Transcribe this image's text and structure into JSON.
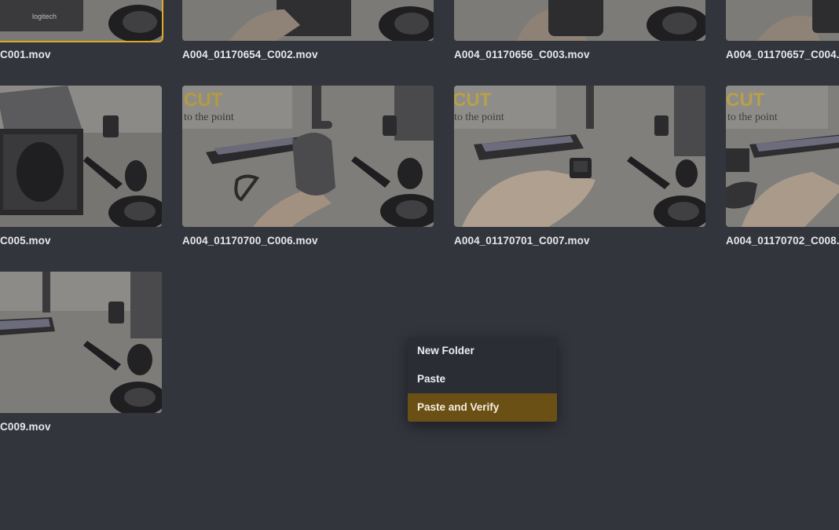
{
  "clips": [
    {
      "id": "c001",
      "name": "C001.mov",
      "selected": true
    },
    {
      "id": "c002",
      "name": "A004_01170654_C002.mov",
      "selected": false
    },
    {
      "id": "c003",
      "name": "A004_01170656_C003.mov",
      "selected": false
    },
    {
      "id": "c004",
      "name": "A004_01170657_C004.",
      "selected": false
    },
    {
      "id": "c005",
      "name": "C005.mov",
      "selected": false
    },
    {
      "id": "c006",
      "name": "A004_01170700_C006.mov",
      "selected": false
    },
    {
      "id": "c007",
      "name": "A004_01170701_C007.mov",
      "selected": false
    },
    {
      "id": "c008",
      "name": "A004_01170702_C008.",
      "selected": false
    },
    {
      "id": "c009",
      "name": "C009.mov",
      "selected": false
    }
  ],
  "thumbnail_texts": {
    "box_brand": "logitech",
    "banner_cut": "CUT",
    "banner_point": "to the point"
  },
  "context_menu": {
    "items": [
      {
        "label": "New Folder",
        "highlighted": false
      },
      {
        "label": "Paste",
        "highlighted": false
      },
      {
        "label": "Paste and Verify",
        "highlighted": true
      }
    ]
  },
  "colors": {
    "background": "#33353d",
    "selection_outline": "#e0a92a",
    "menu_background": "#2b2d34",
    "menu_highlight": "#6b5016"
  }
}
